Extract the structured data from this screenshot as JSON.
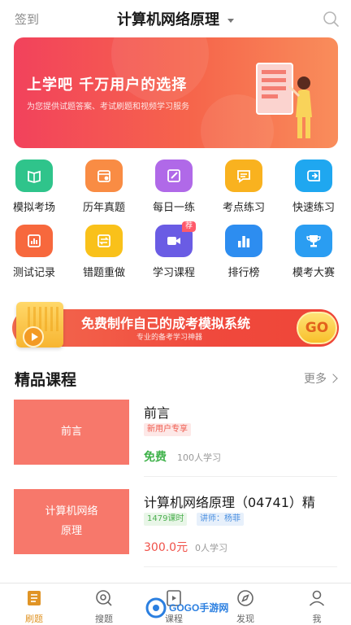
{
  "header": {
    "signin": "签到",
    "title": "计算机网络原理"
  },
  "banner": {
    "headline": "上学吧  千万用户的选择",
    "subtitle": "为您提供试题答案、考试刷题和视频学习服务"
  },
  "features": [
    {
      "label": "模拟考场",
      "color": "#2fc48b",
      "icon": "book-icon"
    },
    {
      "label": "历年真题",
      "color": "#f98c44",
      "icon": "calendar-icon"
    },
    {
      "label": "每日一练",
      "color": "#b069e8",
      "icon": "edit-icon"
    },
    {
      "label": "考点练习",
      "color": "#f9b21f",
      "icon": "chat-icon"
    },
    {
      "label": "快速练习",
      "color": "#1fa7f0",
      "icon": "arrow-box-icon"
    },
    {
      "label": "测试记录",
      "color": "#f7683d",
      "icon": "report-icon"
    },
    {
      "label": "错题重做",
      "color": "#f9c11a",
      "icon": "exchange-icon"
    },
    {
      "label": "学习课程",
      "color": "#6a5ce4",
      "icon": "video-icon",
      "badge": "荐"
    },
    {
      "label": "排行榜",
      "color": "#2d8df0",
      "icon": "bar-chart-icon"
    },
    {
      "label": "模考大赛",
      "color": "#2a9df2",
      "icon": "trophy-icon"
    }
  ],
  "promo": {
    "title": "免费制作自己的成考模拟系统",
    "subtitle": "专业的备考学习神器",
    "go": "GO"
  },
  "section": {
    "title": "精品课程",
    "more": "更多"
  },
  "courses": [
    {
      "thumb": "前言",
      "name": "前言",
      "tag": "新用户专享",
      "price": "免费",
      "learners": "100人学习"
    },
    {
      "thumb_line1": "计算机网络",
      "thumb_line2": "原理",
      "name": "计算机网络原理（04741）精",
      "hours": "1479课时",
      "teacher": "讲师：杨菲",
      "price": "300.0元",
      "learners": "0人学习"
    }
  ],
  "tabs": [
    {
      "label": "刷题"
    },
    {
      "label": "搜题"
    },
    {
      "label": "课程"
    },
    {
      "label": "发现"
    },
    {
      "label": "我"
    }
  ],
  "watermark": "GOGO手游网",
  "colors": {
    "accent": "#e09426",
    "banner": "#f2425c",
    "free": "#3fb24a",
    "price": "#f0524a"
  }
}
